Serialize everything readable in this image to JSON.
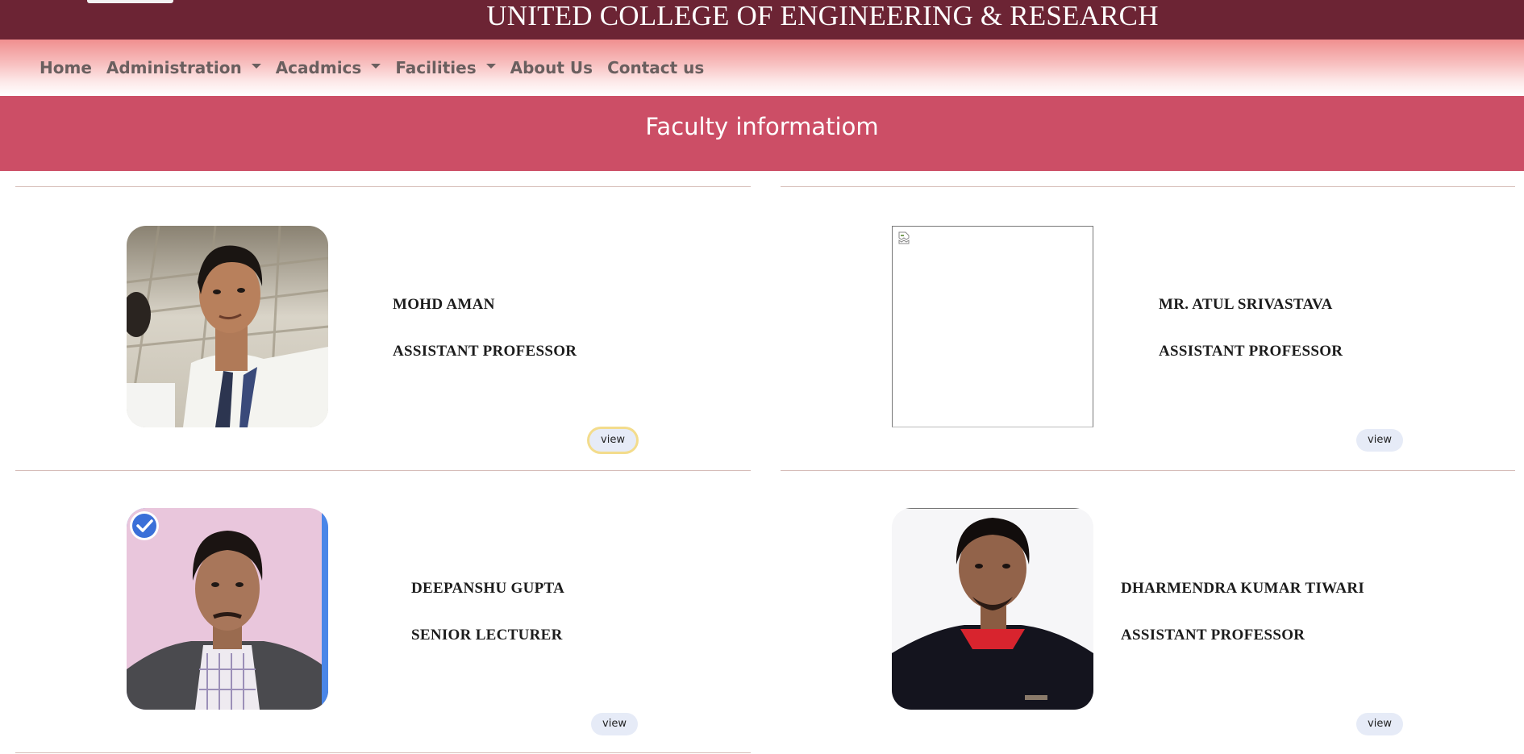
{
  "header": {
    "college_name": "UNITED COLLEGE OF ENGINEERING & RESEARCH"
  },
  "nav": {
    "items": [
      {
        "label": "Home",
        "dropdown": false
      },
      {
        "label": "Administration",
        "dropdown": true
      },
      {
        "label": "Acadmics",
        "dropdown": true
      },
      {
        "label": "Facilities",
        "dropdown": true
      },
      {
        "label": "About Us",
        "dropdown": false
      },
      {
        "label": "Contact us",
        "dropdown": false
      }
    ]
  },
  "section": {
    "title": "Faculty informatiom"
  },
  "faculty": [
    {
      "name": "MOHD AMAN",
      "designation": "ASSISTANT PROFESSOR",
      "button": "view",
      "photo": "photo"
    },
    {
      "name": "MR. ATUL SRIVASTAVA",
      "designation": "ASSISTANT PROFESSOR",
      "button": "view",
      "photo": "broken-image"
    },
    {
      "name": "DEEPANSHU GUPTA",
      "designation": "SENIOR LECTURER",
      "button": "view",
      "photo": "photo"
    },
    {
      "name": "DHARMENDRA KUMAR TIWARI",
      "designation": "ASSISTANT PROFESSOR",
      "button": "view",
      "photo": "photo"
    }
  ],
  "colors": {
    "banner": "#6c2434",
    "section_header": "#cc4e66",
    "nav_text": "#6a5f5f",
    "view_button": "#e6ebf7",
    "selection": "#4a86e8"
  }
}
